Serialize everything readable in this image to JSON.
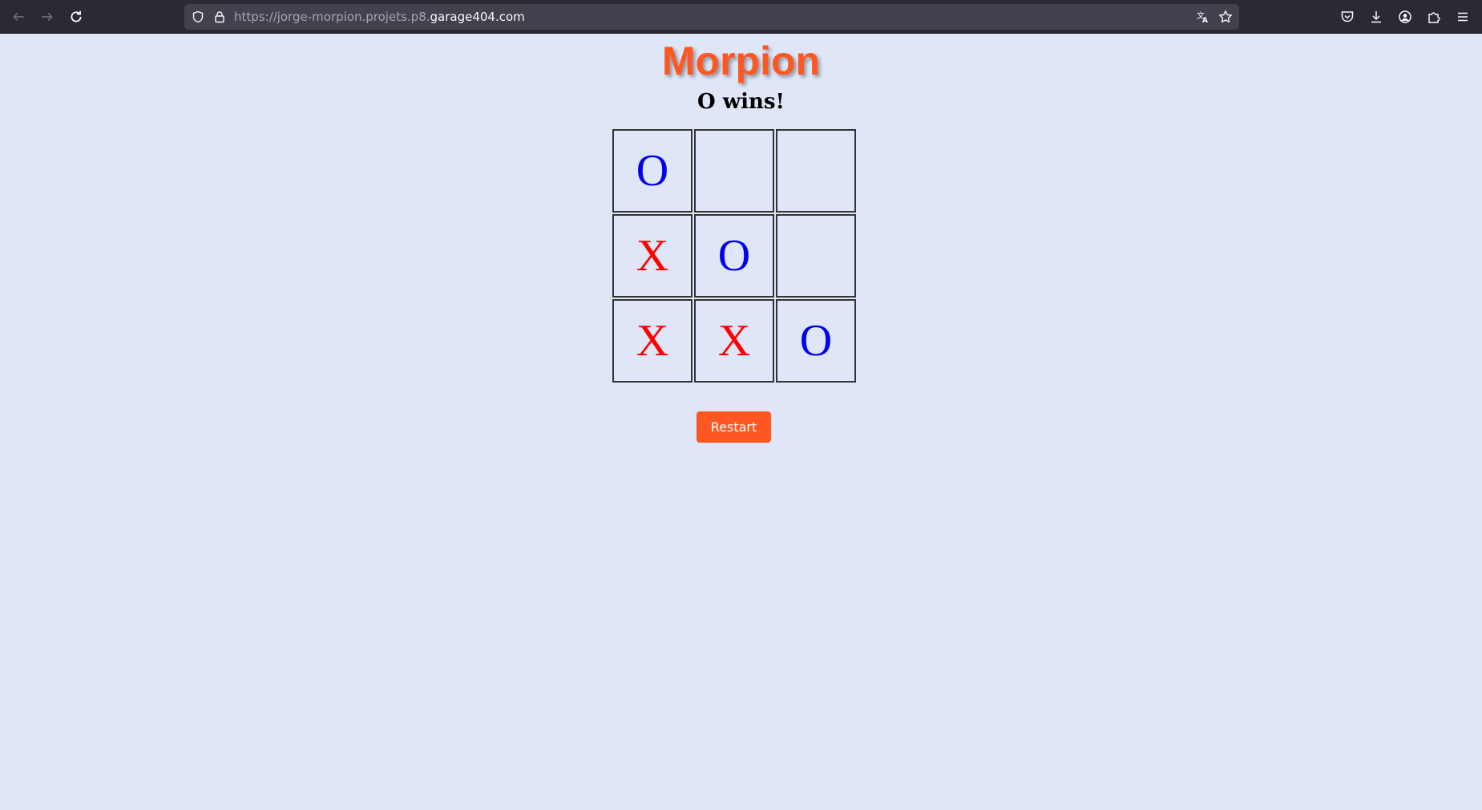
{
  "browser": {
    "url_prefix": "https://jorge-morpion.projets.p8.",
    "url_domain": "garage404.com",
    "icons": {
      "back": "back-arrow-icon",
      "forward": "forward-arrow-icon",
      "reload": "reload-icon",
      "shield": "tracking-shield-icon",
      "lock": "lock-icon",
      "translate": "translate-icon",
      "bookmark": "star-icon",
      "pocket": "pocket-icon",
      "downloads": "download-icon",
      "account": "account-icon",
      "extensions": "extensions-icon",
      "menu": "hamburger-menu-icon"
    }
  },
  "game": {
    "title": "Morpion",
    "status": "O wins!",
    "board": [
      "O",
      "",
      "",
      "X",
      "O",
      "",
      "X",
      "X",
      "O"
    ],
    "restart_label": "Restart",
    "colors": {
      "title": "#ff5722",
      "x": "#ff0000",
      "o": "#0000ee",
      "button": "#ff5722",
      "background": "#dee6f7"
    }
  }
}
